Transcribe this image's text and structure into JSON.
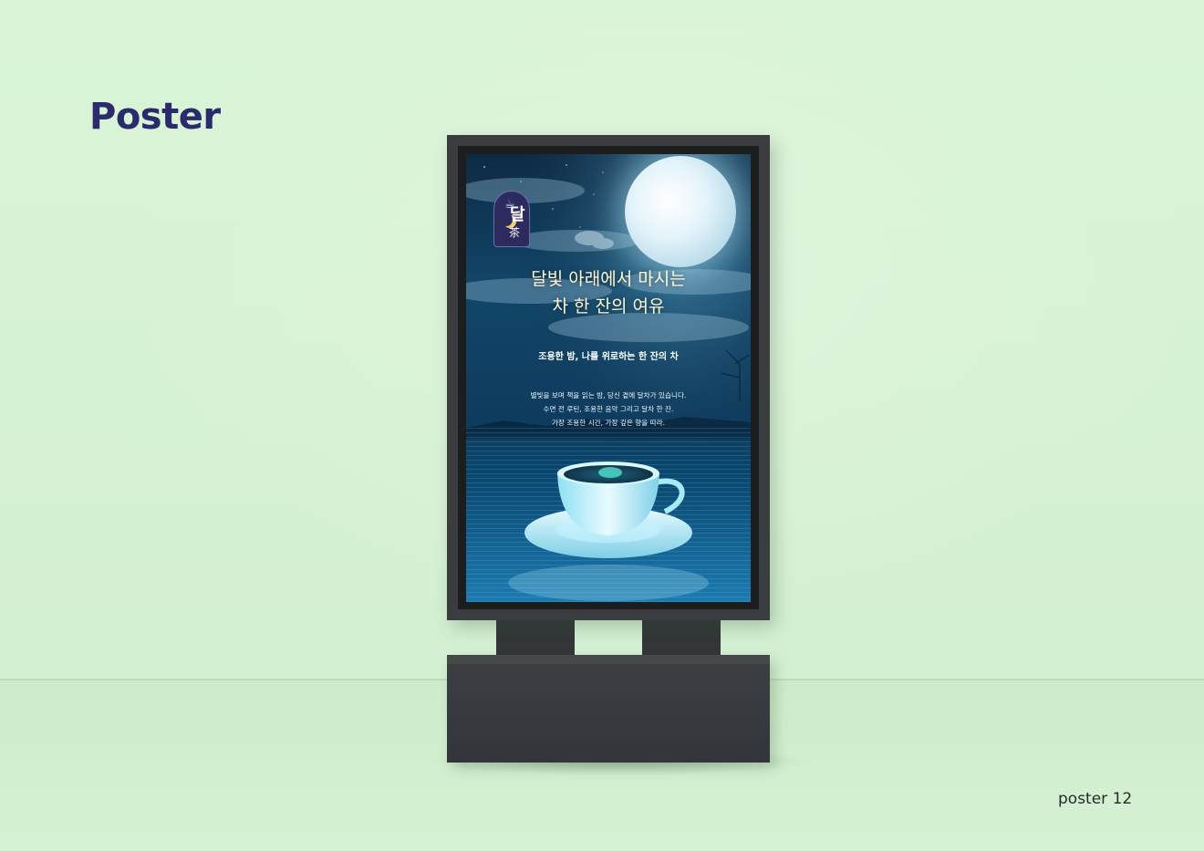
{
  "brand": {
    "title": "Poster"
  },
  "caption": {
    "label": "poster 12"
  },
  "poster": {
    "logo": {
      "text_main": "달",
      "text_sub": "茶"
    },
    "headline": {
      "line1": "달빛 아래에서 마시는",
      "line2": "차 한 잔의 여유"
    },
    "subhead": "조용한 밤, 나를 위로하는 한 잔의 차",
    "body": {
      "line1": "별빛을 보며 책을 읽는 밤, 당신 곁에 달차가 있습니다.",
      "line2": "수면 전 루틴, 조용한 음악 그리고 달차 한 잔.",
      "line3": "가장 조용한 시간, 가장 깊은 향을 따라."
    }
  },
  "colors": {
    "background": "#d8f3d6",
    "brand_text": "#2b2a6b",
    "stand": "#3a3c3f",
    "sky": "#11466a",
    "headline_text": "#fff7d6"
  }
}
